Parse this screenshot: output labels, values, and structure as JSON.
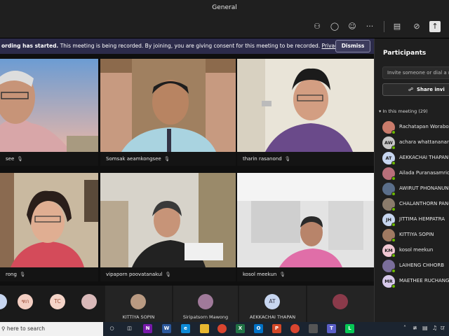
{
  "window": {
    "title": "General"
  },
  "toolbar": {
    "icons": [
      "people-icon",
      "chat-icon",
      "reactions-icon",
      "more-icon",
      "camera-off-icon",
      "mic-off-icon",
      "share-tray-icon"
    ]
  },
  "banner": {
    "bold": "ording has started.",
    "text": "This meeting is being recorded. By joining, you are giving consent for this meeting to be recorded.",
    "link": "Privacy policy",
    "dismiss": "Dismiss"
  },
  "stage": {
    "tiles": [
      {
        "name": "see"
      },
      {
        "name": "Somsak aeamkongsee"
      },
      {
        "name": "tharin rasanond"
      },
      {
        "name": "rong"
      },
      {
        "name": "vipaporn poovatanakul"
      },
      {
        "name": "kosol meekun"
      }
    ]
  },
  "strip": {
    "initials": [
      "ฑก",
      "TC"
    ],
    "people": [
      {
        "name": "KITTIYA SOPIN"
      },
      {
        "name": "Siripatsorn Mawong"
      },
      {
        "name": "AEKKACHAI THAPAN",
        "initials": "AT"
      }
    ]
  },
  "panel": {
    "title": "Participants",
    "invite_placeholder": "Invite someone or dial a nu",
    "share_label": "Share invi",
    "section": "In this meeting (29)",
    "participants": [
      {
        "name": "Rachatapan Woraboo",
        "initials": "",
        "color": "#c97b6b"
      },
      {
        "name": "achara whattananaron",
        "initials": "AW",
        "color": "#c7c7c7"
      },
      {
        "name": "AEKKACHAI THAPAN",
        "initials": "AT",
        "color": "#c7d6f0"
      },
      {
        "name": "Ailada Puranasamriddl",
        "initials": "",
        "color": "#b86f7a"
      },
      {
        "name": "AWIRUT PHONANUN",
        "initials": "",
        "color": "#5a6e8a"
      },
      {
        "name": "CHALANTHORN PAN-",
        "initials": "",
        "color": "#8a7b6b"
      },
      {
        "name": "JITTIMA HEMPATRA",
        "initials": "JH",
        "color": "#c7d6f0"
      },
      {
        "name": "KITTIYA SOPIN",
        "initials": "",
        "color": "#a07a62"
      },
      {
        "name": "kosol meekun",
        "initials": "KM",
        "color": "#f0c7d2"
      },
      {
        "name": "LAIHENG CHHORB",
        "initials": "",
        "color": "#7a6e9a"
      },
      {
        "name": "MAETHEE RUCHANGK",
        "initials": "MR",
        "color": "#d7c9ea"
      }
    ]
  },
  "taskbar": {
    "search": "here to search"
  }
}
